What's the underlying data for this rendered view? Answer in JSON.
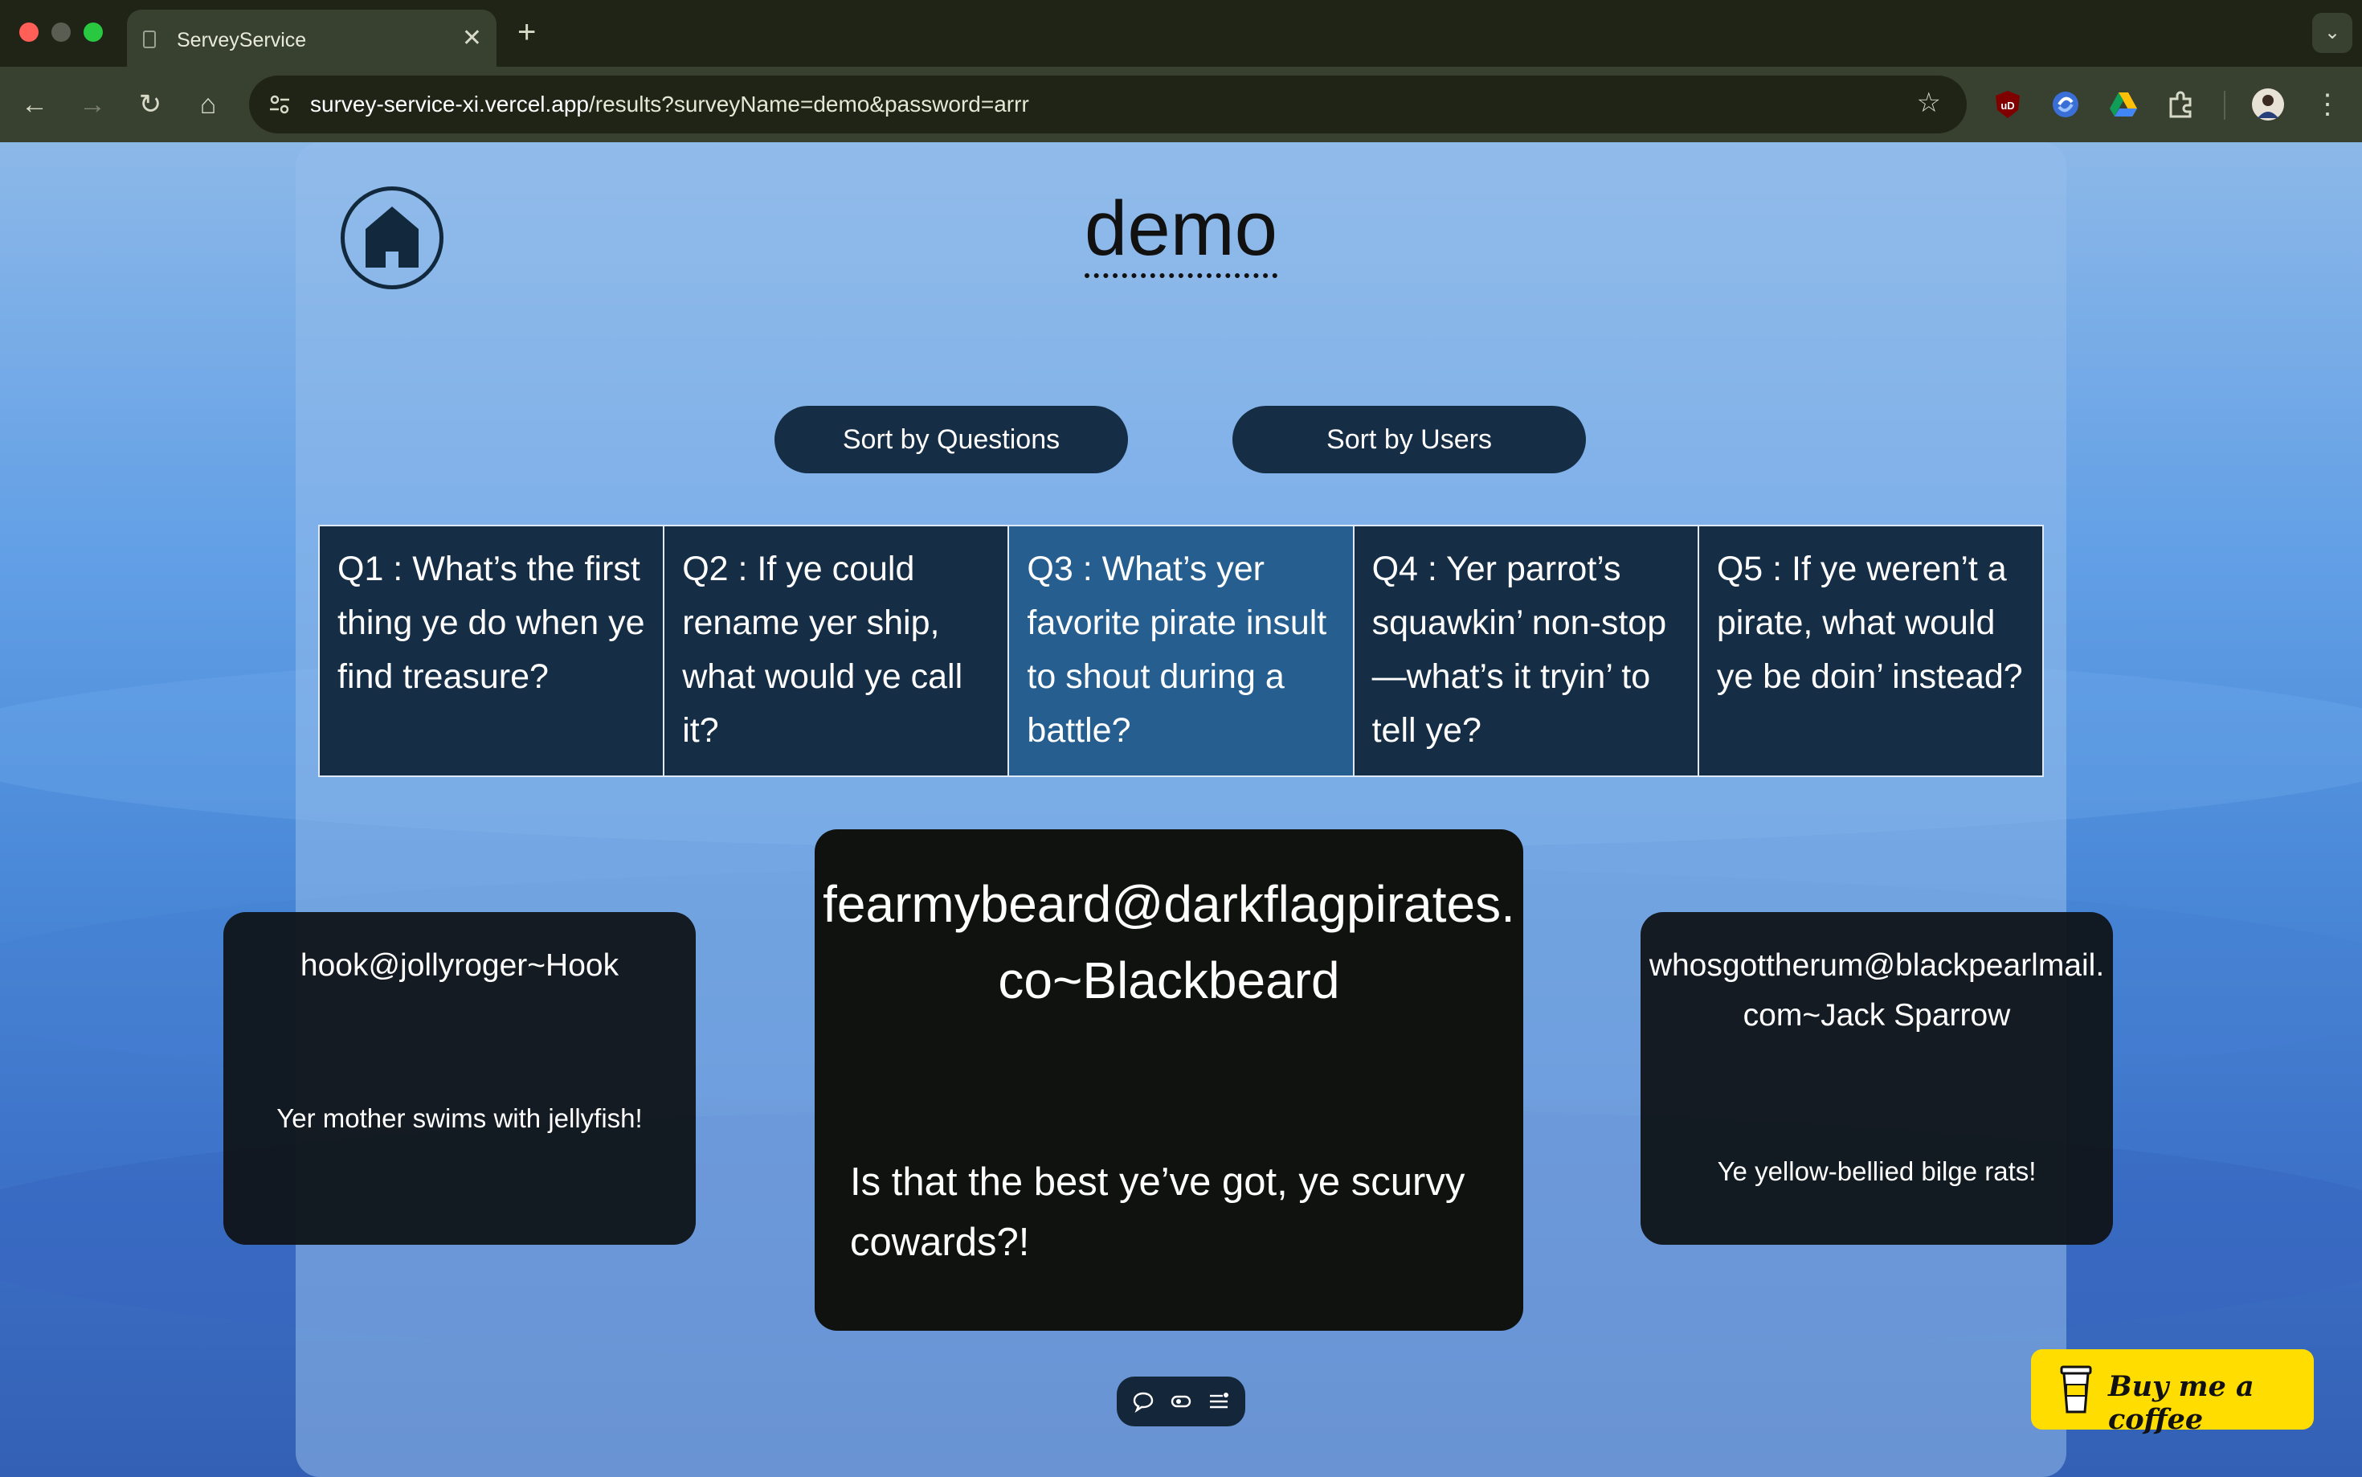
{
  "browser": {
    "tab_title": "ServeyService",
    "url_host": "survey-service-xi.vercel.app",
    "url_path": "/results?surveyName=demo&password=arrr"
  },
  "page": {
    "title": "demo",
    "sort_by_questions": "Sort by Questions",
    "sort_by_users": "Sort by Users",
    "questions": [
      {
        "label": "Q1 : What’s the first thing ye do when ye find treasure?"
      },
      {
        "label": "Q2 : If ye could rename yer ship, what would ye call it?"
      },
      {
        "label": "Q3 : What’s yer favorite pirate insult to shout during a battle?"
      },
      {
        "label": "Q4 : Yer parrot’s squawkin’ non-stop—what’s it tryin’ to tell ye?"
      },
      {
        "label": "Q5 : If ye weren’t a pirate, what would ye be doin’ instead?"
      }
    ],
    "cards": [
      {
        "user": "hook@jollyroger~Hook",
        "answer": "Yer mother swims with jellyfish!"
      },
      {
        "user": "fearmybeard@darkflagpirates.co~Blackbeard",
        "answer": "Is that the best ye’ve got, ye scurvy cowards?!"
      },
      {
        "user": "whosgottherum@blackpearlmail.com~Jack Sparrow",
        "answer": "Ye yellow-bellied bilge rats!"
      }
    ],
    "coffee_button": "Buy me a coffee"
  },
  "colors": {
    "accent_navy": "#152d45",
    "active_question": "#255e8f",
    "coffee_yellow": "#ffdd00"
  }
}
